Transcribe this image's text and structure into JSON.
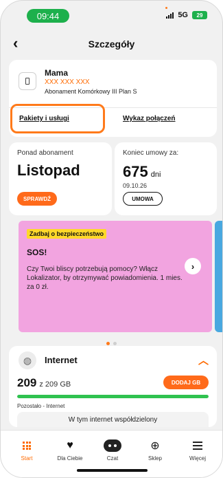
{
  "status_bar": {
    "time": "09:44",
    "network": "5G",
    "battery": "29"
  },
  "header": {
    "title": "Szczegóły",
    "back_icon": "chevron-left-icon"
  },
  "contact": {
    "name": "Mama",
    "number": "XXX XXX XXX",
    "plan": "Abonament Komórkowy III Plan  S",
    "icon": "phone-icon"
  },
  "tabs": {
    "pakiety": "Pakiety i usługi",
    "wykaz": "Wykaz połączeń"
  },
  "subscription": {
    "label": "Ponad abonament",
    "month": "Listopad",
    "button": "SPRAWDŹ"
  },
  "contract_end": {
    "label": "Koniec umowy za:",
    "days": "675",
    "days_unit": "dni",
    "date": "09.10.26",
    "button": "UMOWA"
  },
  "promo": {
    "tag": "Zadbaj o bezpieczeństwo",
    "title": "SOS!",
    "text": "Czy Twoi bliscy potrzebują pomocy? Włącz Lokalizator, by otrzymywać powiadomienia. 1 mies. za 0 zł.",
    "arrow_icon": "chevron-right-icon",
    "carousel_active_index": 0,
    "carousel_count": 2,
    "colors": {
      "background": "#f2a4e0",
      "tag": "#ffd82a"
    }
  },
  "internet": {
    "title": "Internet",
    "remaining": "209",
    "total_text": "z 209 GB",
    "remaining_fraction": 1.0,
    "caption": "Pozostało - Internet",
    "add_button": "DODAJ GB",
    "shared_label": "W tym internet współdzielony",
    "icon": "globe-icon",
    "toggle_icon": "chevron-up-icon"
  },
  "bottom_nav": {
    "items": [
      {
        "label": "Start",
        "icon": "grid-icon",
        "active": true
      },
      {
        "label": "Dla Ciebie",
        "icon": "heart-icon",
        "active": false
      },
      {
        "label": "Czat",
        "icon": "chat-icon",
        "active": false
      },
      {
        "label": "Sklep",
        "icon": "basket-icon",
        "active": false
      },
      {
        "label": "Więcej",
        "icon": "menu-icon",
        "active": false
      }
    ]
  },
  "colors": {
    "accent": "#ff6a1a",
    "success": "#2fc24f",
    "time_pill": "#1db04c"
  }
}
